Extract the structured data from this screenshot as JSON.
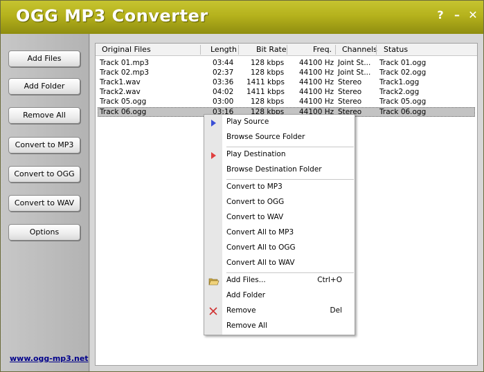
{
  "app": {
    "title": "OGG MP3 Converter",
    "help_glyph": "?",
    "minimize_glyph": "–",
    "close_glyph": "✕"
  },
  "sidebar": {
    "buttons": [
      {
        "label": "Add Files"
      },
      {
        "label": "Add Folder"
      },
      {
        "label": "Remove All"
      },
      {
        "label": "Convert to MP3"
      },
      {
        "label": "Convert to OGG"
      },
      {
        "label": "Convert to WAV"
      },
      {
        "label": "Options"
      }
    ],
    "link": "www.ogg-mp3.net"
  },
  "table": {
    "columns": [
      "Original Files",
      "Length",
      "Bit Rate",
      "Freq.",
      "Channels",
      "Status"
    ],
    "rows": [
      {
        "file": "Track 01.mp3",
        "length": "03:44",
        "bitrate": "128 kbps",
        "freq": "44100 Hz",
        "channels": "Joint St...",
        "status": "Track 01.ogg"
      },
      {
        "file": "Track 02.mp3",
        "length": "02:37",
        "bitrate": "128 kbps",
        "freq": "44100 Hz",
        "channels": "Joint St...",
        "status": "Track 02.ogg"
      },
      {
        "file": "Track1.wav",
        "length": "03:36",
        "bitrate": "1411 kbps",
        "freq": "44100 Hz",
        "channels": "Stereo",
        "status": "Track1.ogg"
      },
      {
        "file": "Track2.wav",
        "length": "04:02",
        "bitrate": "1411 kbps",
        "freq": "44100 Hz",
        "channels": "Stereo",
        "status": "Track2.ogg"
      },
      {
        "file": "Track 05.ogg",
        "length": "03:00",
        "bitrate": "128 kbps",
        "freq": "44100 Hz",
        "channels": "Stereo",
        "status": "Track 05.ogg"
      },
      {
        "file": "Track 06.ogg",
        "length": "03:16",
        "bitrate": "128 kbps",
        "freq": "44100 Hz",
        "channels": "Stereo",
        "status": "Track 06.ogg"
      }
    ]
  },
  "context_menu": {
    "items": [
      {
        "label": "Play Source",
        "icon": "play-blue-icon"
      },
      {
        "label": "Browse Source Folder"
      },
      {
        "label": "Play Destination",
        "icon": "play-red-icon"
      },
      {
        "label": "Browse Destination Folder"
      },
      {
        "label": "Convert to MP3"
      },
      {
        "label": "Convert to OGG"
      },
      {
        "label": "Convert to WAV"
      },
      {
        "label": "Convert All to MP3"
      },
      {
        "label": "Convert All to OGG"
      },
      {
        "label": "Convert All to WAV"
      },
      {
        "label": "Add Files...",
        "shortcut": "Ctrl+O",
        "icon": "open-folder-icon"
      },
      {
        "label": "Add Folder"
      },
      {
        "label": "Remove",
        "shortcut": "Del",
        "icon": "remove-x-icon"
      },
      {
        "label": "Remove All"
      }
    ]
  },
  "colors": {
    "title_bar": "#b5b21c",
    "link": "#00008b",
    "selection": "#c3c3c3"
  }
}
